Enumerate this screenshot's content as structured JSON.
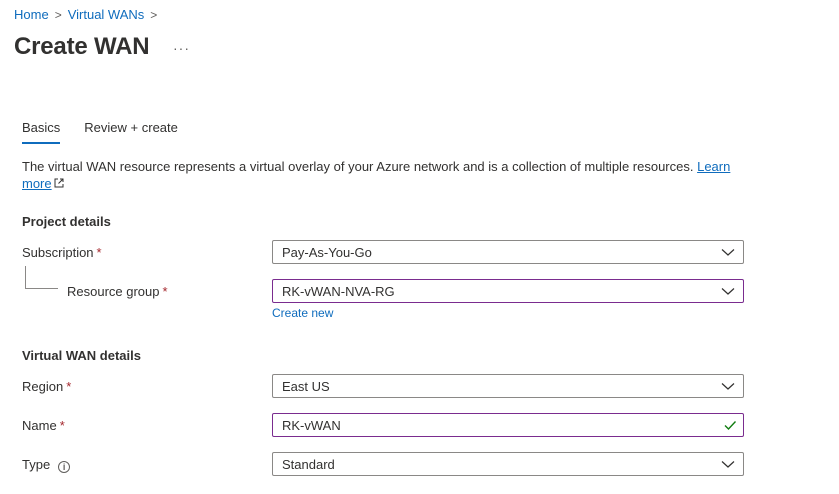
{
  "breadcrumb": {
    "home": "Home",
    "parent": "Virtual WANs",
    "sep": ">"
  },
  "page": {
    "title": "Create WAN",
    "more": "···"
  },
  "tabs": [
    {
      "label": "Basics"
    },
    {
      "label": "Review + create"
    }
  ],
  "description": {
    "text": "The virtual WAN resource represents a virtual overlay of your Azure network and is a collection of multiple resources. ",
    "link_word1": "Learn",
    "link_word2": "more"
  },
  "project_details": {
    "title": "Project details",
    "subscription": {
      "label": "Subscription",
      "value": "Pay-As-You-Go"
    },
    "resource_group": {
      "label": "Resource group",
      "value": "RK-vWAN-NVA-RG",
      "create_new": "Create new"
    }
  },
  "wan_details": {
    "title": "Virtual WAN details",
    "region": {
      "label": "Region",
      "value": "East US"
    },
    "name": {
      "label": "Name",
      "value": "RK-vWAN"
    },
    "type": {
      "label": "Type",
      "value": "Standard"
    }
  },
  "required_mark": "*",
  "info_glyph": "i",
  "colors": {
    "accent": "#0f6cbd",
    "focus": "#7a2c8f",
    "required": "#a4262c",
    "valid": "#107c10"
  }
}
